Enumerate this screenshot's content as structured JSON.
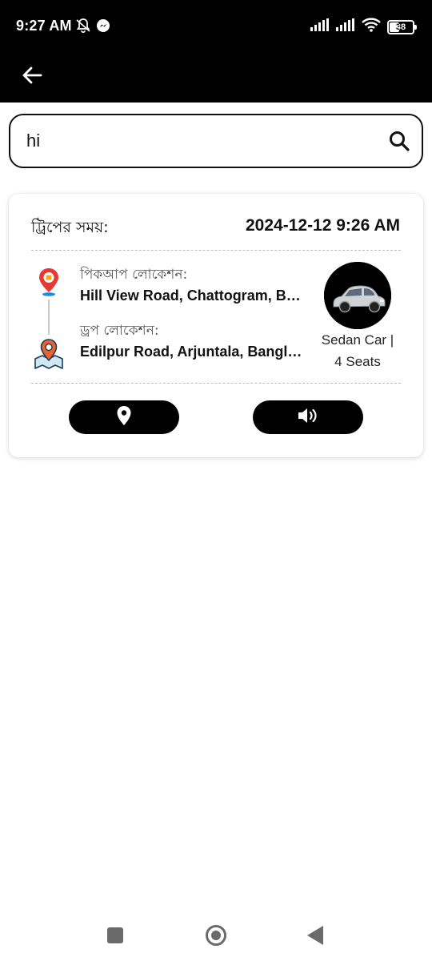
{
  "status_bar": {
    "time": "9:27 AM",
    "battery": "38",
    "left_icons": [
      "notifications-off-icon",
      "messenger-icon"
    ],
    "right_icons": [
      "signal-icon",
      "signal-icon",
      "wifi-icon",
      "battery-icon"
    ]
  },
  "app_bar": {
    "back_icon": "arrow-left-icon"
  },
  "search": {
    "value": "hi",
    "icon": "search-icon"
  },
  "trip": {
    "time_label": "ট্রিপের সময়:",
    "time_value": "2024-12-12 9:26 AM",
    "pickup_label": "পিকআপ লোকেশন:",
    "pickup_value": "Hill View Road, Chattogram, Bangladesh",
    "drop_label": "ড্রপ লোকেশন:",
    "drop_value": "Edilpur Road, Arjuntala, Bangladesh",
    "car_type": "Sedan Car |",
    "seats": "4 Seats",
    "location_button_icon": "location-pin-icon",
    "sound_button_icon": "volume-icon"
  },
  "nav_bar": {
    "icons": [
      "recents-icon",
      "home-icon",
      "back-icon"
    ]
  },
  "colors": {
    "header_bg": "#000000",
    "card_bg": "#ffffff",
    "button_bg": "#000000",
    "pickup_pin": "#e53935",
    "drop_pin": "#e8642c"
  }
}
